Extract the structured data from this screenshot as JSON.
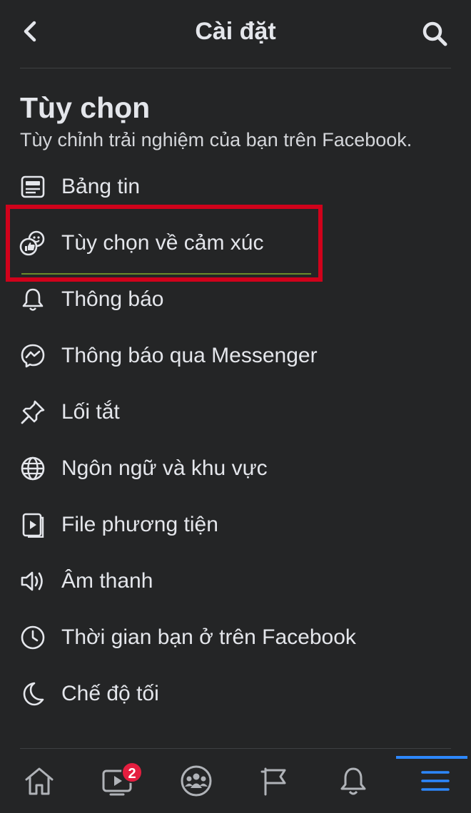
{
  "header": {
    "title": "Cài đặt"
  },
  "section": {
    "title": "Tùy chọn",
    "subtitle": "Tùy chỉnh trải nghiệm của bạn trên Facebook."
  },
  "menu": {
    "items": [
      {
        "label": "Bảng tin",
        "icon": "news-feed-icon"
      },
      {
        "label": "Tùy chọn về cảm xúc",
        "icon": "reactions-icon"
      },
      {
        "label": "Thông báo",
        "icon": "bell-icon"
      },
      {
        "label": "Thông báo qua Messenger",
        "icon": "messenger-icon"
      },
      {
        "label": "Lối tắt",
        "icon": "pin-icon"
      },
      {
        "label": "Ngôn ngữ và khu vực",
        "icon": "globe-icon"
      },
      {
        "label": "File phương tiện",
        "icon": "media-file-icon"
      },
      {
        "label": "Âm thanh",
        "icon": "speaker-icon"
      },
      {
        "label": "Thời gian bạn ở trên Facebook",
        "icon": "clock-icon"
      },
      {
        "label": "Chế độ tối",
        "icon": "moon-icon"
      }
    ]
  },
  "tabbar": {
    "watch_badge": "2",
    "active_tab": "menu"
  },
  "colors": {
    "background": "#242526",
    "text": "#e4e6eb",
    "highlight_border": "#d0021b",
    "accent": "#2d88ff",
    "badge": "#e41e3f"
  }
}
